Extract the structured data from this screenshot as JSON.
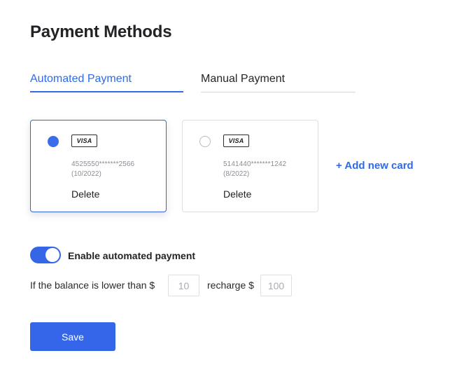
{
  "page": {
    "title": "Payment Methods"
  },
  "tabs": [
    {
      "label": "Automated Payment",
      "active": true
    },
    {
      "label": "Manual Payment",
      "active": false
    }
  ],
  "cards": [
    {
      "brand": "VISA",
      "number": "4525550*******2566",
      "expiry": "(10/2022)",
      "delete_label": "Delete",
      "selected": true
    },
    {
      "brand": "VISA",
      "number": "5141440*******1242",
      "expiry": "(8/2022)",
      "delete_label": "Delete",
      "selected": false
    }
  ],
  "add_card_label": "+ Add new card",
  "auto_payment": {
    "toggle_label": "Enable automated payment",
    "enabled": true,
    "threshold_text": "If the balance is lower than $",
    "threshold_value": "10",
    "recharge_text": "recharge $",
    "recharge_value": "100"
  },
  "save_label": "Save",
  "colors": {
    "accent": "#2f6ae8",
    "button": "#3566ea",
    "border": "#dcdfe4",
    "muted_text": "#8a8d93"
  }
}
